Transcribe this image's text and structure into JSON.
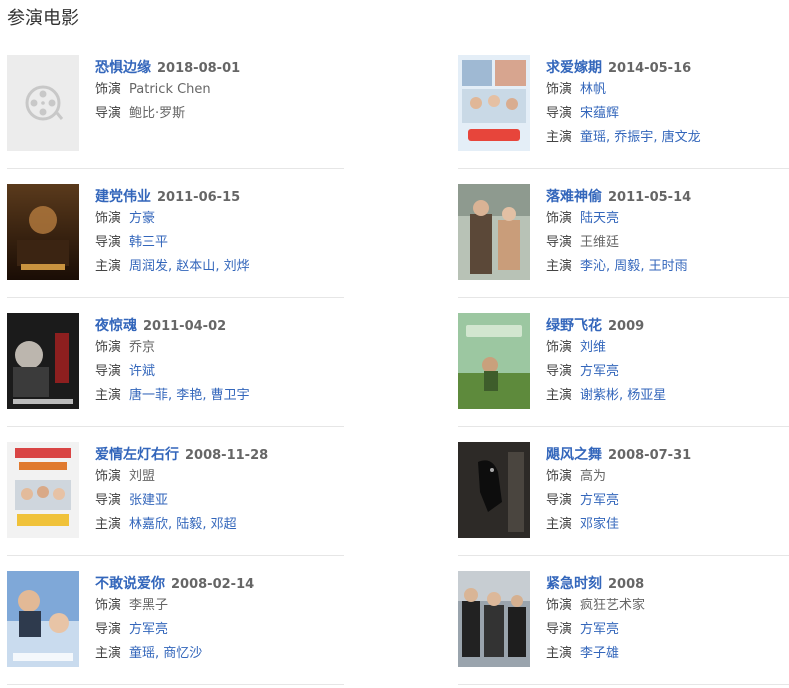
{
  "section_title": "参演电影",
  "movies": [
    {
      "title": "恐惧边缘",
      "date": "2018-08-01",
      "roles": [
        {
          "label": "饰演",
          "names": [
            "Patrick Chen"
          ],
          "linked": false
        },
        {
          "label": "导演",
          "names": [
            "鲍比·罗斯"
          ],
          "linked": false
        }
      ]
    },
    {
      "title": "求爱嫁期",
      "date": "2014-05-16",
      "roles": [
        {
          "label": "饰演",
          "names": [
            "林帆"
          ],
          "linked": true
        },
        {
          "label": "导演",
          "names": [
            "宋蕴辉"
          ],
          "linked": true
        },
        {
          "label": "主演",
          "names": [
            "童瑶",
            "乔振宇",
            "唐文龙"
          ],
          "linked": true
        }
      ]
    },
    {
      "title": "建党伟业",
      "date": "2011-06-15",
      "roles": [
        {
          "label": "饰演",
          "names": [
            "方豪"
          ],
          "linked": true
        },
        {
          "label": "导演",
          "names": [
            "韩三平"
          ],
          "linked": true
        },
        {
          "label": "主演",
          "names": [
            "周润发",
            "赵本山",
            "刘烨"
          ],
          "linked": true
        }
      ]
    },
    {
      "title": "落难神偷",
      "date": "2011-05-14",
      "roles": [
        {
          "label": "饰演",
          "names": [
            "陆天亮"
          ],
          "linked": true
        },
        {
          "label": "导演",
          "names": [
            "王维廷"
          ],
          "linked": false
        },
        {
          "label": "主演",
          "names": [
            "李沁",
            "周毅",
            "王时雨"
          ],
          "linked": true
        }
      ]
    },
    {
      "title": "夜惊魂",
      "date": "2011-04-02",
      "roles": [
        {
          "label": "饰演",
          "names": [
            "乔京"
          ],
          "linked": false
        },
        {
          "label": "导演",
          "names": [
            "许斌"
          ],
          "linked": true
        },
        {
          "label": "主演",
          "names": [
            "唐一菲",
            "李艳",
            "曹卫宇"
          ],
          "linked": true
        }
      ]
    },
    {
      "title": "绿野飞花",
      "date": "2009",
      "roles": [
        {
          "label": "饰演",
          "names": [
            "刘维"
          ],
          "linked": true
        },
        {
          "label": "导演",
          "names": [
            "方军亮"
          ],
          "linked": true
        },
        {
          "label": "主演",
          "names": [
            "谢紫彬",
            "杨亚星"
          ],
          "linked": true
        }
      ]
    },
    {
      "title": "爱情左灯右行",
      "date": "2008-11-28",
      "roles": [
        {
          "label": "饰演",
          "names": [
            "刘盟"
          ],
          "linked": false
        },
        {
          "label": "导演",
          "names": [
            "张建亚"
          ],
          "linked": true
        },
        {
          "label": "主演",
          "names": [
            "林嘉欣",
            "陆毅",
            "邓超"
          ],
          "linked": true
        }
      ]
    },
    {
      "title": "飓风之舞",
      "date": "2008-07-31",
      "roles": [
        {
          "label": "饰演",
          "names": [
            "高为"
          ],
          "linked": false
        },
        {
          "label": "导演",
          "names": [
            "方军亮"
          ],
          "linked": true
        },
        {
          "label": "主演",
          "names": [
            "邓家佳"
          ],
          "linked": true
        }
      ]
    },
    {
      "title": "不敢说爱你",
      "date": "2008-02-14",
      "roles": [
        {
          "label": "饰演",
          "names": [
            "李黑子"
          ],
          "linked": false
        },
        {
          "label": "导演",
          "names": [
            "方军亮"
          ],
          "linked": true
        },
        {
          "label": "主演",
          "names": [
            "童瑶",
            "商忆沙"
          ],
          "linked": true
        }
      ]
    },
    {
      "title": "紧急时刻",
      "date": "2008",
      "roles": [
        {
          "label": "饰演",
          "names": [
            "疯狂艺术家"
          ],
          "linked": false
        },
        {
          "label": "导演",
          "names": [
            "方军亮"
          ],
          "linked": true
        },
        {
          "label": "主演",
          "names": [
            "李子雄"
          ],
          "linked": true
        }
      ]
    }
  ],
  "colors": {
    "link": "#3366bb",
    "label": "#444444",
    "muted": "#666666",
    "divider": "#e6e6e6"
  }
}
